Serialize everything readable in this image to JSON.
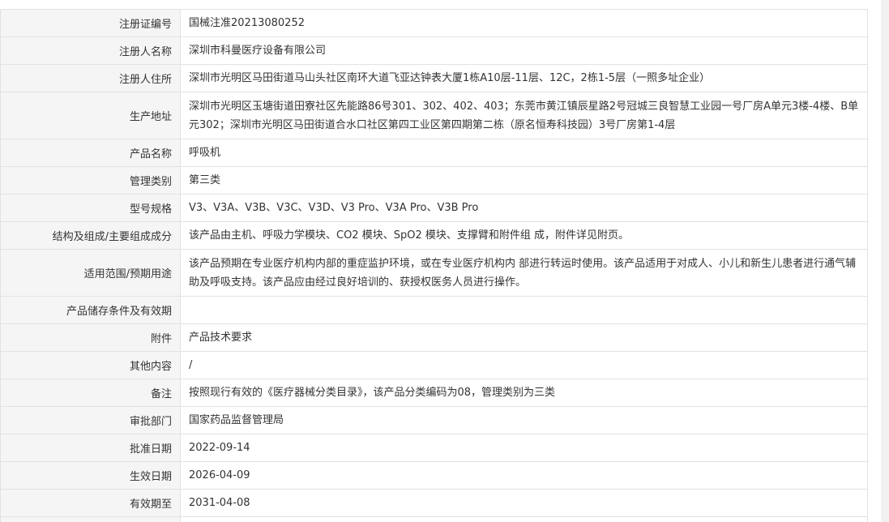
{
  "rows": [
    {
      "label": "注册证编号",
      "value": "国械注准20213080252"
    },
    {
      "label": "注册人名称",
      "value": "深圳市科曼医疗设备有限公司"
    },
    {
      "label": "注册人住所",
      "value": "深圳市光明区马田街道马山头社区南环大道飞亚达钟表大厦1栋A10层-11层、12C，2栋1-5层（一照多址企业）"
    },
    {
      "label": "生产地址",
      "value": "深圳市光明区玉塘街道田寮社区先能路86号301、302、402、403；东莞市黄江镇辰星路2号冠城三良智慧工业园一号厂房A单元3楼-4楼、B单元302；深圳市光明区马田街道合水口社区第四工业区第四期第二栋（原名恒寿科技园）3号厂房第1-4层"
    },
    {
      "label": "产品名称",
      "value": "呼吸机"
    },
    {
      "label": "管理类别",
      "value": "第三类"
    },
    {
      "label": "型号规格",
      "value": "V3、V3A、V3B、V3C、V3D、V3 Pro、V3A Pro、V3B Pro"
    },
    {
      "label": "结构及组成/主要组成成分",
      "value": "该产品由主机、呼吸力学模块、CO2 模块、SpO2 模块、支撑臂和附件组 成，附件详见附页。"
    },
    {
      "label": "适用范围/预期用途",
      "value": "该产品预期在专业医疗机构内部的重症监护环境，或在专业医疗机构内 部进行转运时使用。该产品适用于对成人、小儿和新生儿患者进行通气辅 助及呼吸支持。该产品应由经过良好培训的、获授权医务人员进行操作。"
    },
    {
      "label": "产品储存条件及有效期",
      "value": ""
    },
    {
      "label": "附件",
      "value": "产品技术要求"
    },
    {
      "label": "其他内容",
      "value": "/"
    },
    {
      "label": "备注",
      "value": "按照现行有效的《医疗器械分类目录》，该产品分类编码为08，管理类别为三类"
    },
    {
      "label": "审批部门",
      "value": "国家药品监督管理局"
    },
    {
      "label": "批准日期",
      "value": "2022-09-14"
    },
    {
      "label": "生效日期",
      "value": "2026-04-09"
    },
    {
      "label": "有效期至",
      "value": "2031-04-08"
    },
    {
      "label": "",
      "value": ""
    }
  ]
}
